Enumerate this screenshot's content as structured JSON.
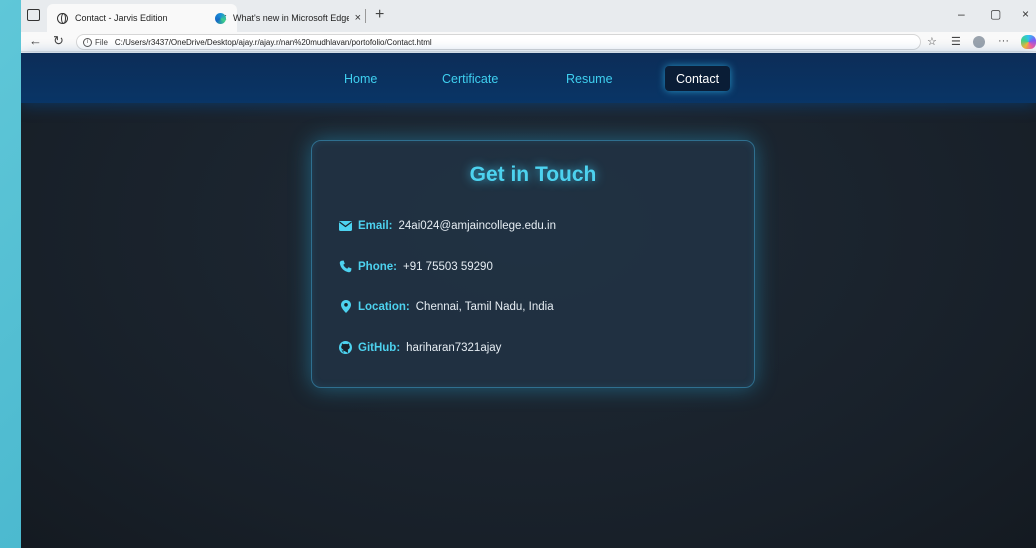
{
  "browser": {
    "tabs": [
      {
        "title": "Contact - Jarvis Edition",
        "icon": "globe-icon",
        "active": true
      },
      {
        "title": "What's new in Microsoft Edge",
        "icon": "edge-icon",
        "active": false
      }
    ],
    "new_tab": "+",
    "close_symbol": "×",
    "address": {
      "scheme_label": "File",
      "url": "C:/Users/r3437/OneDrive/Desktop/ajay.r/ajay.r/nan%20mudhlavan/portofolio/Contact.html"
    },
    "window_controls": {
      "minimize": "–",
      "maximize": "▢",
      "close": "×"
    }
  },
  "nav": {
    "items": [
      {
        "label": "Home",
        "active": false
      },
      {
        "label": "Certificate",
        "active": false
      },
      {
        "label": "Resume",
        "active": false
      },
      {
        "label": "Contact",
        "active": true
      }
    ]
  },
  "contact": {
    "title": "Get in Touch",
    "items": [
      {
        "icon": "envelope-icon",
        "label": "Email:",
        "value": "24ai024@amjaincollege.edu.in"
      },
      {
        "icon": "phone-icon",
        "label": "Phone:",
        "value": "+91 75503 59290"
      },
      {
        "icon": "location-pin-icon",
        "label": "Location:",
        "value": "Chennai, Tamil Nadu, India"
      },
      {
        "icon": "github-icon",
        "label": "GitHub:",
        "value": "hariharan7321ajay"
      }
    ]
  },
  "colors": {
    "accent": "#4dd2ef",
    "nav_bg": "#0c2d58",
    "page_bg": "#182029",
    "text": "#e6edf3"
  }
}
